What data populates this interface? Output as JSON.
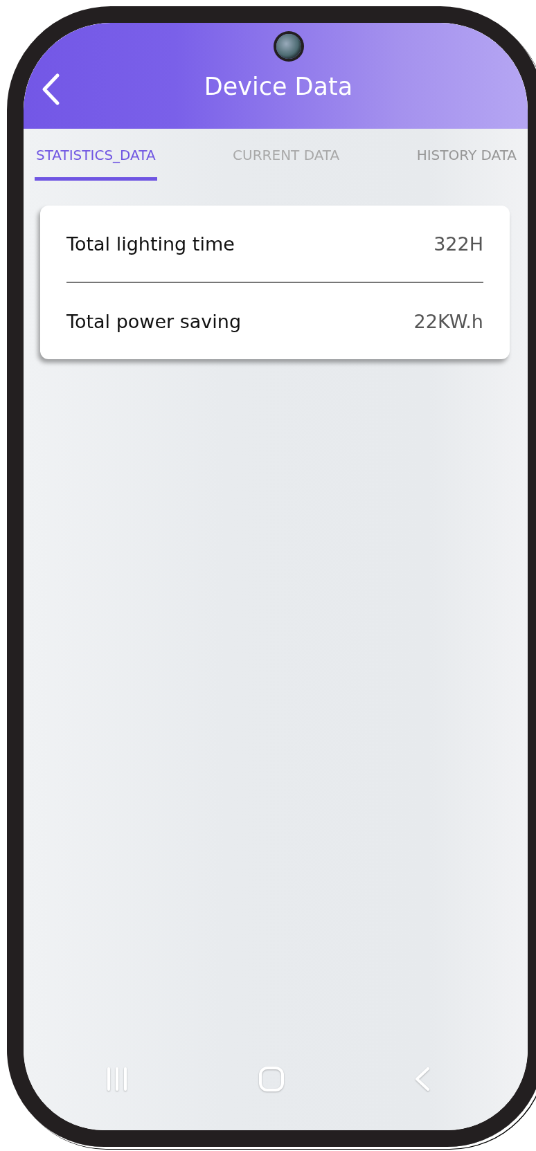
{
  "header": {
    "title": "Device Data"
  },
  "tabs": [
    {
      "label": "STATISTICS_DATA",
      "selected": true
    },
    {
      "label": "CURRENT DATA",
      "selected": false
    },
    {
      "label": "HISTORY DATA",
      "selected": false
    }
  ],
  "stats": [
    {
      "label": "Total lighting time",
      "value": "322H"
    },
    {
      "label": "Total power saving",
      "value": "22KW.h"
    }
  ]
}
